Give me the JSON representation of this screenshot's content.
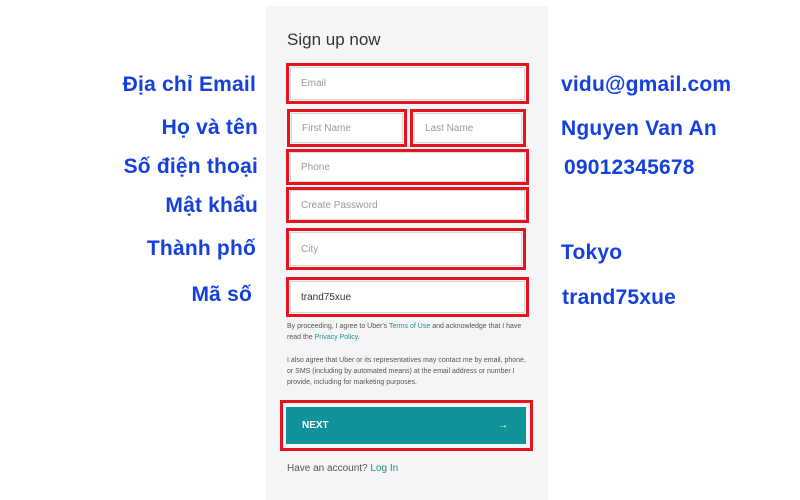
{
  "form": {
    "title": "Sign up now",
    "email_placeholder": "Email",
    "first_name_placeholder": "First Name",
    "last_name_placeholder": "Last Name",
    "phone_placeholder": "Phone",
    "password_placeholder": "Create Password",
    "city_placeholder": "City",
    "code_value": "trand75xue",
    "terms": {
      "prefix": "By proceeding, I agree to Uber's",
      "terms_link": "Terms of Use",
      "middle": "and acknowledge that I have read the",
      "privacy_link": "Privacy Policy",
      "suffix": "."
    },
    "consent_text": "I also agree that Uber or its representatives may contact me by email, phone, or SMS (including by automated means) at the email address or number I provide, including for marketing purposes.",
    "next_label": "NEXT",
    "next_arrow": "→",
    "have_account_text": "Have an account?",
    "login_link": "Log In"
  },
  "labels_left": {
    "email": "Địa chỉ Email",
    "name": "Họ và tên",
    "phone": "Số điện thoại",
    "password": "Mật khẩu",
    "city": "Thành phố",
    "code": "Mã số"
  },
  "examples_right": {
    "email": "vidu@gmail.com",
    "name": "Nguyen Van An",
    "phone": "09012345678",
    "city": "Tokyo",
    "code": "trand75xue"
  },
  "colors": {
    "highlight": "#e3141e",
    "caption": "#1540e0",
    "button": "#11939a"
  }
}
